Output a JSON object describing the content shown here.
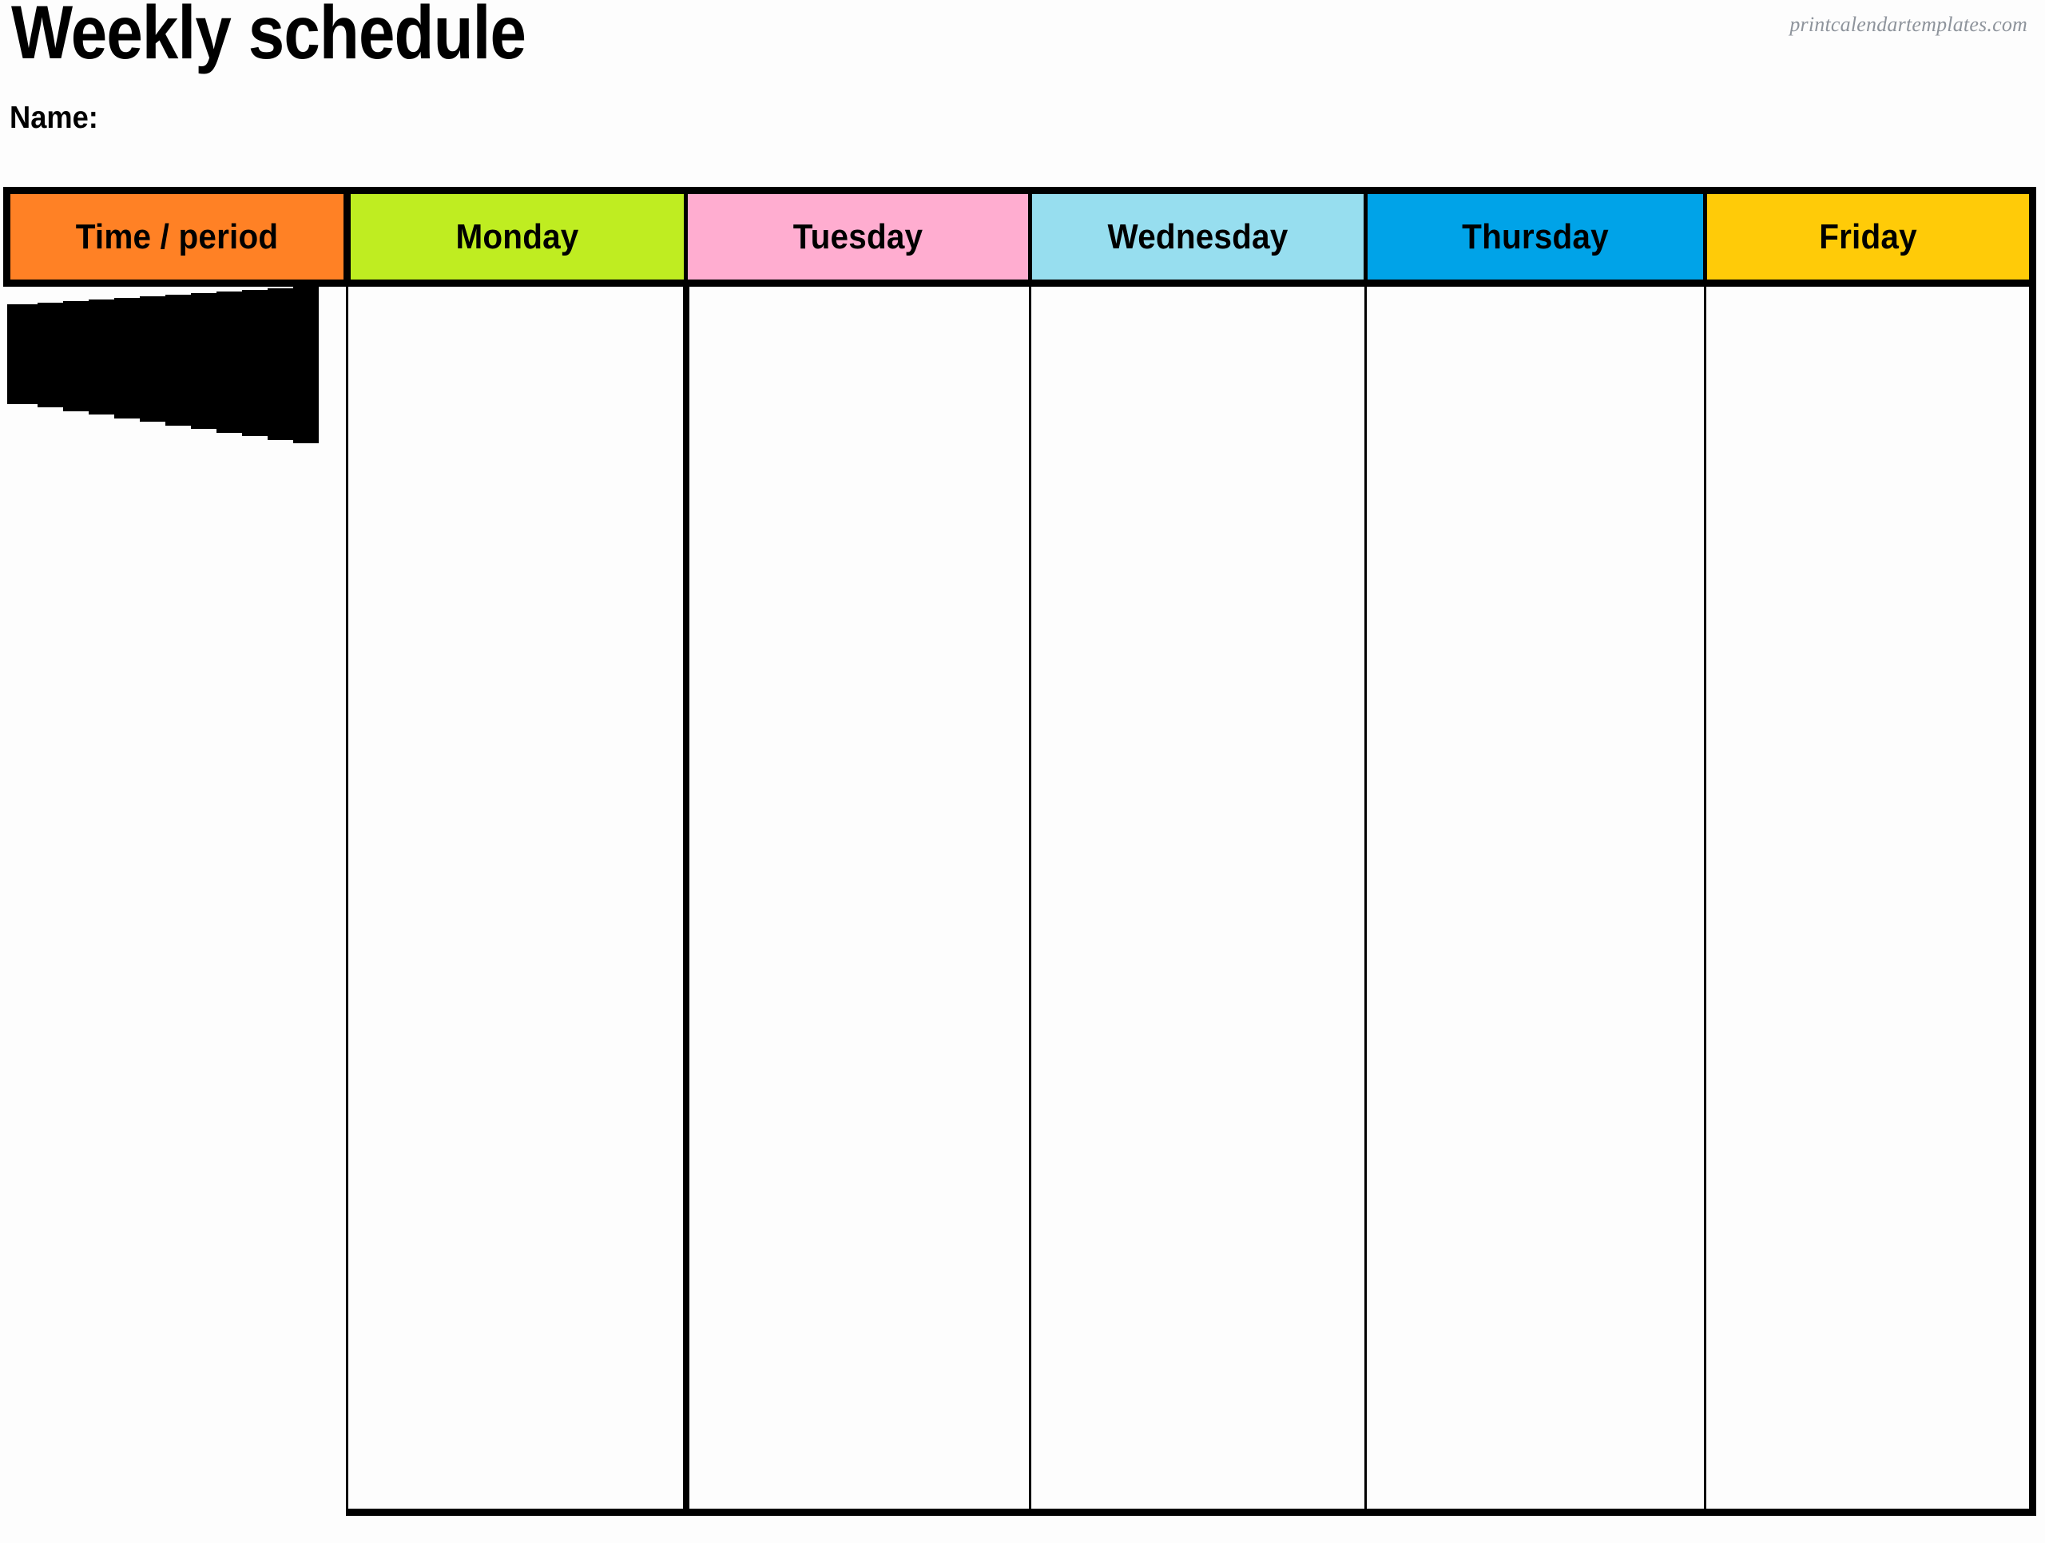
{
  "page": {
    "title": "Weekly schedule",
    "name_label": "Name:",
    "watermark": "printcalendartemplates.com"
  },
  "table": {
    "columns": [
      {
        "key": "time",
        "label": "Time / period",
        "header_color": "#FF8125"
      },
      {
        "key": "monday",
        "label": "Monday",
        "header_color": "#BFED21"
      },
      {
        "key": "tuesday",
        "label": "Tuesday",
        "header_color": "#FFADD0"
      },
      {
        "key": "wednesday",
        "label": "Wednesday",
        "header_color": "#97DEEF"
      },
      {
        "key": "thursday",
        "label": "Thursday",
        "header_color": "#00A3E8"
      },
      {
        "key": "friday",
        "label": "Friday",
        "header_color": "#FFCB08"
      }
    ],
    "row_count": 13,
    "rows": [
      {
        "time": "",
        "monday": "",
        "tuesday": "",
        "wednesday": "",
        "thursday": "",
        "friday": ""
      },
      {
        "time": "",
        "monday": "",
        "tuesday": "",
        "wednesday": "",
        "thursday": "",
        "friday": ""
      },
      {
        "time": "",
        "monday": "",
        "tuesday": "",
        "wednesday": "",
        "thursday": "",
        "friday": ""
      },
      {
        "time": "",
        "monday": "",
        "tuesday": "",
        "wednesday": "",
        "thursday": "",
        "friday": ""
      },
      {
        "time": "",
        "monday": "",
        "tuesday": "",
        "wednesday": "",
        "thursday": "",
        "friday": ""
      },
      {
        "time": "",
        "monday": "",
        "tuesday": "",
        "wednesday": "",
        "thursday": "",
        "friday": ""
      },
      {
        "time": "",
        "monday": "",
        "tuesday": "",
        "wednesday": "",
        "thursday": "",
        "friday": ""
      },
      {
        "time": "",
        "monday": "",
        "tuesday": "",
        "wednesday": "",
        "thursday": "",
        "friday": ""
      },
      {
        "time": "",
        "monday": "",
        "tuesday": "",
        "wednesday": "",
        "thursday": "",
        "friday": ""
      },
      {
        "time": "",
        "monday": "",
        "tuesday": "",
        "wednesday": "",
        "thursday": "",
        "friday": ""
      },
      {
        "time": "",
        "monday": "",
        "tuesday": "",
        "wednesday": "",
        "thursday": "",
        "friday": ""
      },
      {
        "time": "",
        "monday": "",
        "tuesday": "",
        "wednesday": "",
        "thursday": "",
        "friday": ""
      },
      {
        "time": "",
        "monday": "",
        "tuesday": "",
        "wednesday": "",
        "thursday": "",
        "friday": ""
      }
    ]
  },
  "style": {
    "border_color": "#000000",
    "cell_background": "#fdfdfd",
    "page_background": "#fdfdfd",
    "watermark_color": "#8e949c"
  }
}
